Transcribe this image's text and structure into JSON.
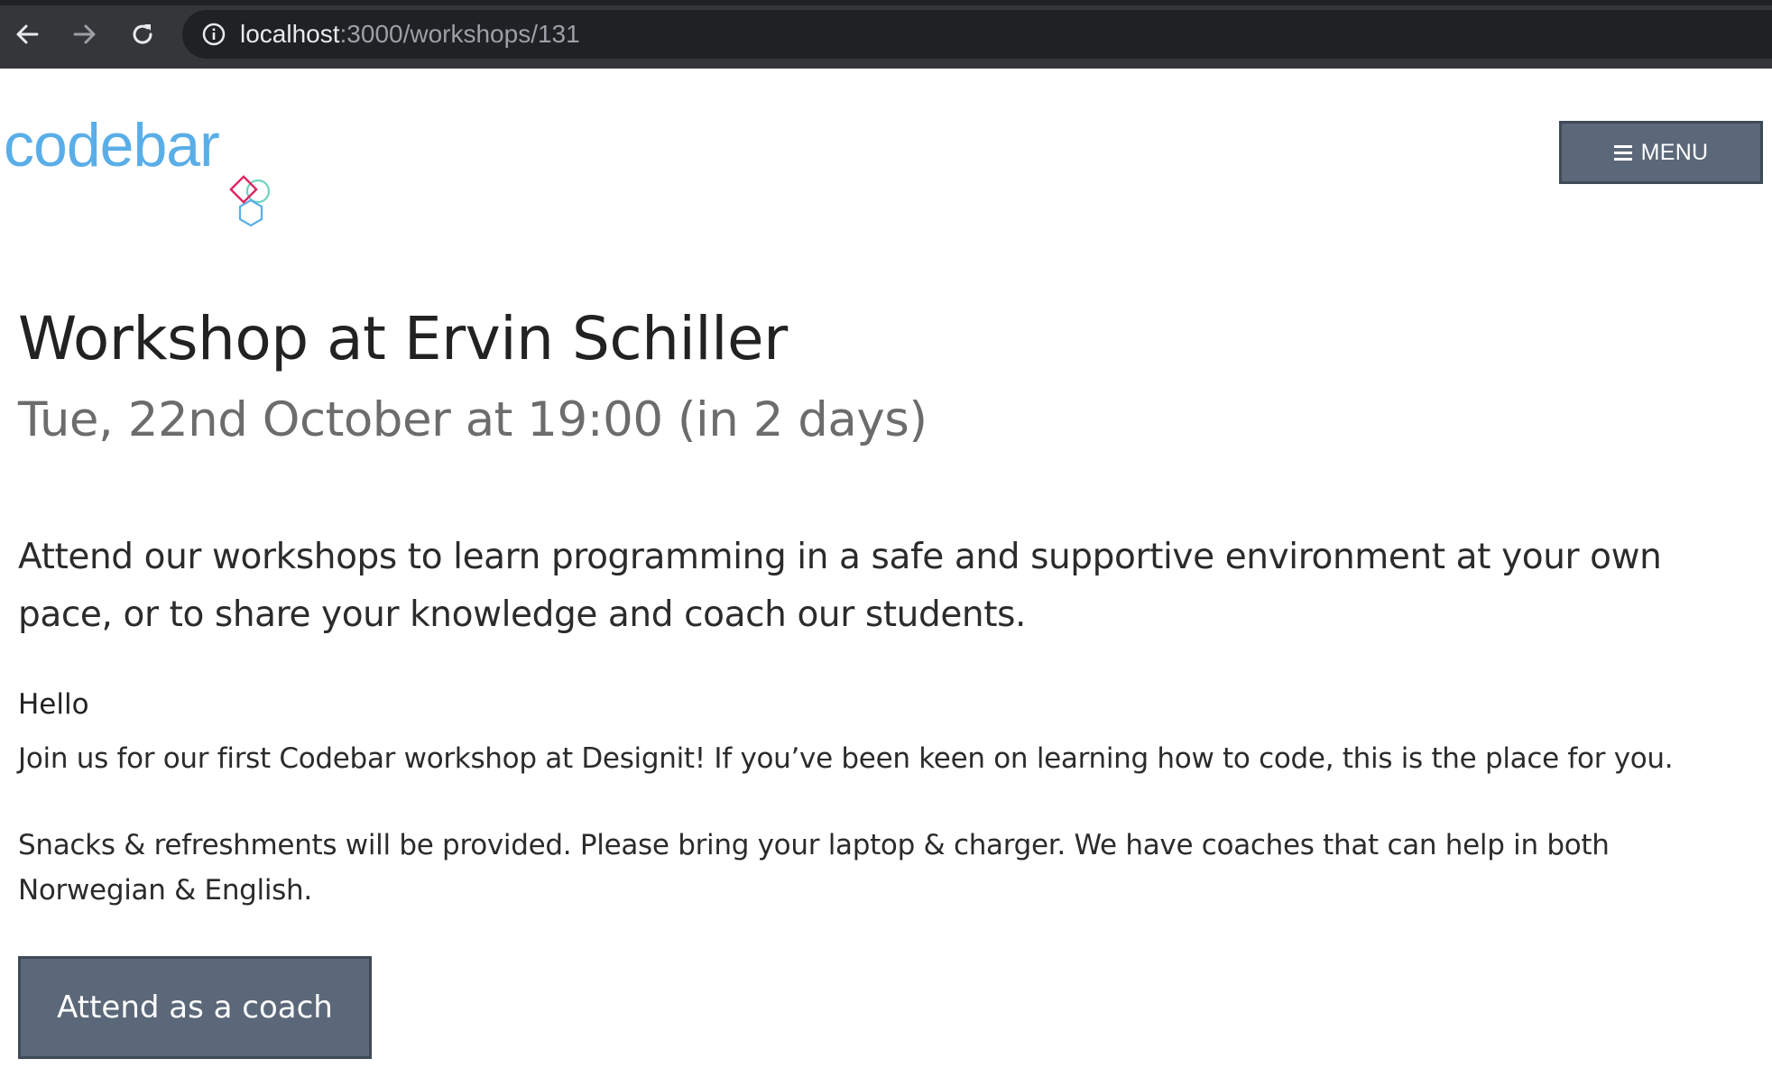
{
  "browser": {
    "url_host": "localhost",
    "url_path": ":3000/workshops/131",
    "icons": [
      "back-arrow-icon",
      "forward-arrow-icon",
      "reload-icon",
      "info-icon"
    ]
  },
  "header": {
    "logo_text": "codebar",
    "menu_label": "MENU"
  },
  "main": {
    "title": "Workshop at Ervin Schiller",
    "datetime": "Tue, 22nd October at 19:00 (in 2 days)",
    "lead": "Attend our workshops to learn programming in a safe and supportive environment at your own pace, or to share your knowledge and coach our students.",
    "greeting": "Hello",
    "paragraph1": "Join us for our first Codebar workshop at Designit! If you’ve been keen on learning how to code, this is the place for you.",
    "paragraph2": "Snacks & refreshments will be provided. Please bring your laptop & charger. We have coaches that can help in both Norwegian & English.",
    "attend_coach_label": "Attend as a coach"
  },
  "colors": {
    "chrome": "#35363a",
    "omnibox": "#202124",
    "button": "#5b6879",
    "logo": "#5aaee8"
  }
}
